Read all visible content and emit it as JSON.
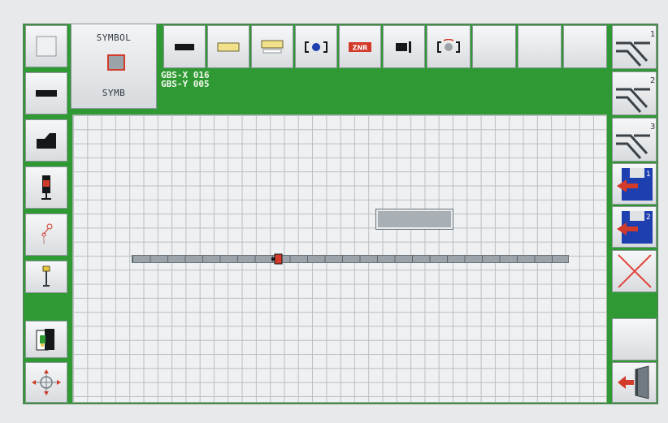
{
  "symbol_panel": {
    "title": "SYMBOL",
    "subtitle": "SYMB"
  },
  "coords": {
    "x_label": "GBS-X",
    "x_value": "016",
    "y_label": "GBS-Y",
    "y_value": "005"
  },
  "toolbar": {
    "tools": [
      "black-bar-icon",
      "yellow-bar-icon",
      "yellow-bar-white-underline-icon",
      "blue-dot-bracket-icon",
      "red-znr-label-icon",
      "signal-endpoint-icon",
      "gray-dot-bracket-icon",
      "empty-slot",
      "empty-slot",
      "empty-slot"
    ],
    "znr_label": "ZNR"
  },
  "right_panel": {
    "switch_numbers": [
      "1",
      "2",
      "3"
    ],
    "floppy_numbers": [
      "1",
      "2"
    ]
  },
  "left_tools": [
    "blank-square-icon",
    "black-bar-icon",
    "ramp-icon",
    "signal-light-icon",
    "pin-pink-icon",
    "yellow-pin-icon",
    "exit-door-icon",
    "move-crosshair-icon"
  ],
  "colors": {
    "background_green": "#2f9a33",
    "grid": "#b9c0c4",
    "accent_red": "#d23a2a",
    "accent_blue": "#1e3fb0"
  }
}
